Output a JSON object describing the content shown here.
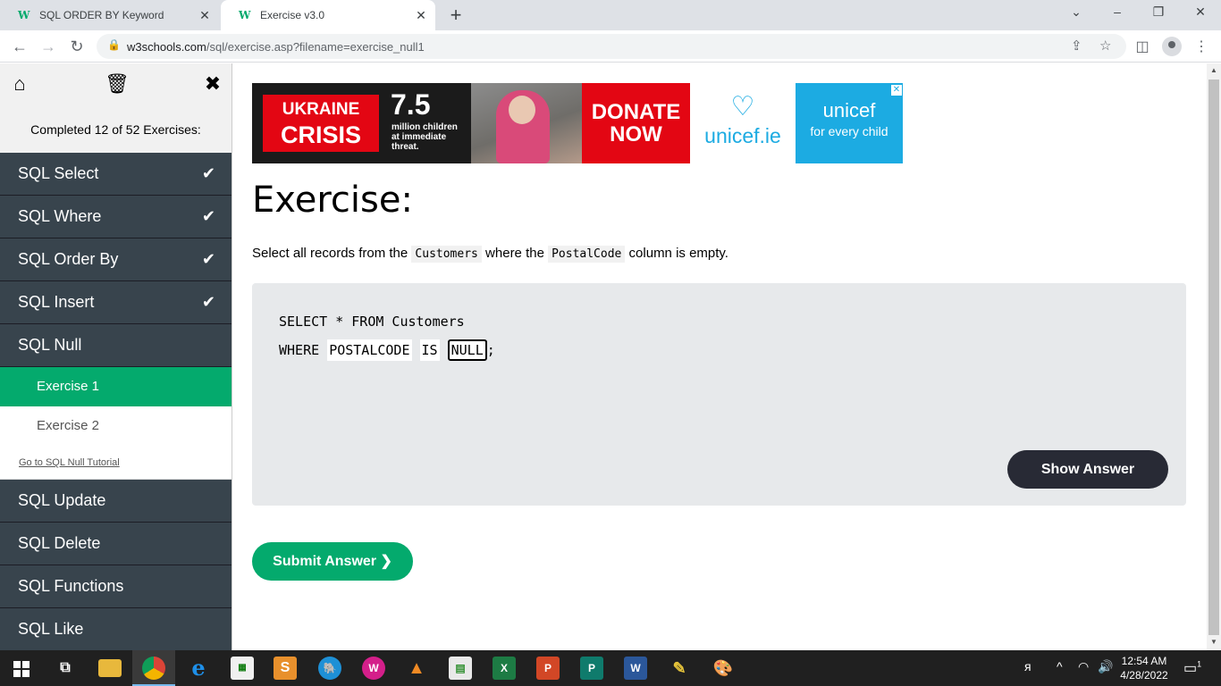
{
  "browser": {
    "tabs": [
      {
        "title": "SQL ORDER BY Keyword",
        "active": false
      },
      {
        "title": "Exercise v3.0",
        "active": true
      }
    ],
    "url_host": "w3schools.com",
    "url_path": "/sql/exercise.asp?filename=exercise_null1"
  },
  "sidebar": {
    "progress_text": "Completed 12 of 52 Exercises:",
    "chapters_done": [
      {
        "label": "SQL Select",
        "completed": true
      },
      {
        "label": "SQL Where",
        "completed": true
      },
      {
        "label": "SQL Order By",
        "completed": true
      },
      {
        "label": "SQL Insert",
        "completed": true
      }
    ],
    "open_chapter": "SQL Null",
    "exercises": [
      {
        "label": "Exercise 1",
        "current": true
      },
      {
        "label": "Exercise 2",
        "current": false
      }
    ],
    "tutorial_link": "Go to SQL Null Tutorial",
    "chapters_rest": [
      {
        "label": "SQL Update"
      },
      {
        "label": "SQL Delete"
      },
      {
        "label": "SQL Functions"
      },
      {
        "label": "SQL Like"
      }
    ],
    "check_glyph": "✔"
  },
  "ad": {
    "crisis_line1": "UKRAINE",
    "crisis_line2": "CRISIS",
    "number": "7.5",
    "subtext_1": "million children",
    "subtext_2": "at immediate",
    "subtext_3": "threat.",
    "donate_1": "DONATE",
    "donate_2": "NOW",
    "unicef_domain": "unicef.ie",
    "unicef_brand": "unicef",
    "unicef_tagline": "for every child"
  },
  "exercise": {
    "title": "Exercise:",
    "desc_1": "Select all records from the",
    "desc_code_1": "Customers",
    "desc_2": "where the",
    "desc_code_2": "PostalCode",
    "desc_3": "column is empty.",
    "line1": "SELECT * FROM Customers",
    "line2_prefix": "WHERE",
    "input_1": "POSTALCODE",
    "input_2": "IS",
    "input_3": "NULL",
    "line2_suffix": ";",
    "show_answer_label": "Show Answer",
    "submit_label": "Submit Answer ❯"
  },
  "taskbar": {
    "time": "12:54 AM",
    "date": "4/28/2022",
    "notification_count": "1"
  }
}
